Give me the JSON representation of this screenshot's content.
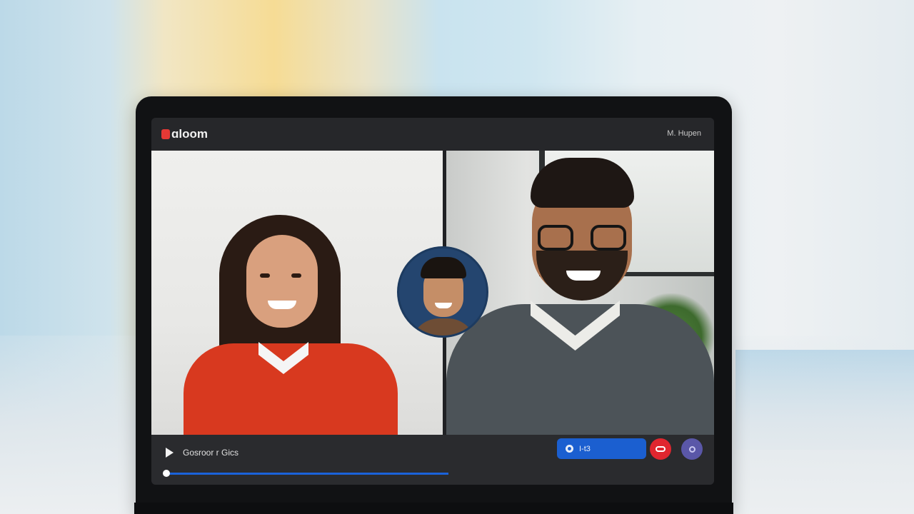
{
  "app": {
    "logo_text": "ɑloom",
    "user_name": "M. Hupen"
  },
  "video": {
    "participants": [
      {
        "role": "main-left"
      },
      {
        "role": "main-right"
      },
      {
        "role": "picture-in-picture"
      }
    ]
  },
  "controls": {
    "session_title": "Gosroor r Gics",
    "progress": 1.0,
    "participants_label": "I-t3",
    "end_icon": "end-call-icon",
    "more_icon": "more-icon"
  },
  "colors": {
    "accent": "#1b5fd0",
    "end_call": "#e0262f",
    "more": "#5a57a8",
    "logo": "#e53935"
  }
}
